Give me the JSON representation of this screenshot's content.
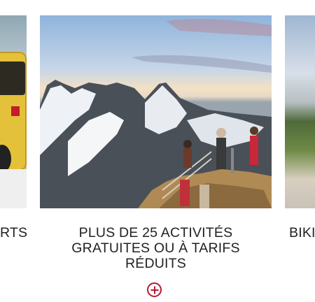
{
  "carousel": {
    "left_card": {
      "caption": "RTS",
      "image_subject": "yellow bus"
    },
    "center_card": {
      "caption": "PLUS DE 25 ACTIVITÉS GRATUITES OU À TARIFS RÉDUITS",
      "image_subject": "hikers on a rocky summit viewing snowy mountains",
      "more_button_icon": "plus-circle-icon"
    },
    "right_card": {
      "caption": "BIKI",
      "image_subject": "mountain landscape"
    },
    "accent_color": "#b31b34"
  }
}
